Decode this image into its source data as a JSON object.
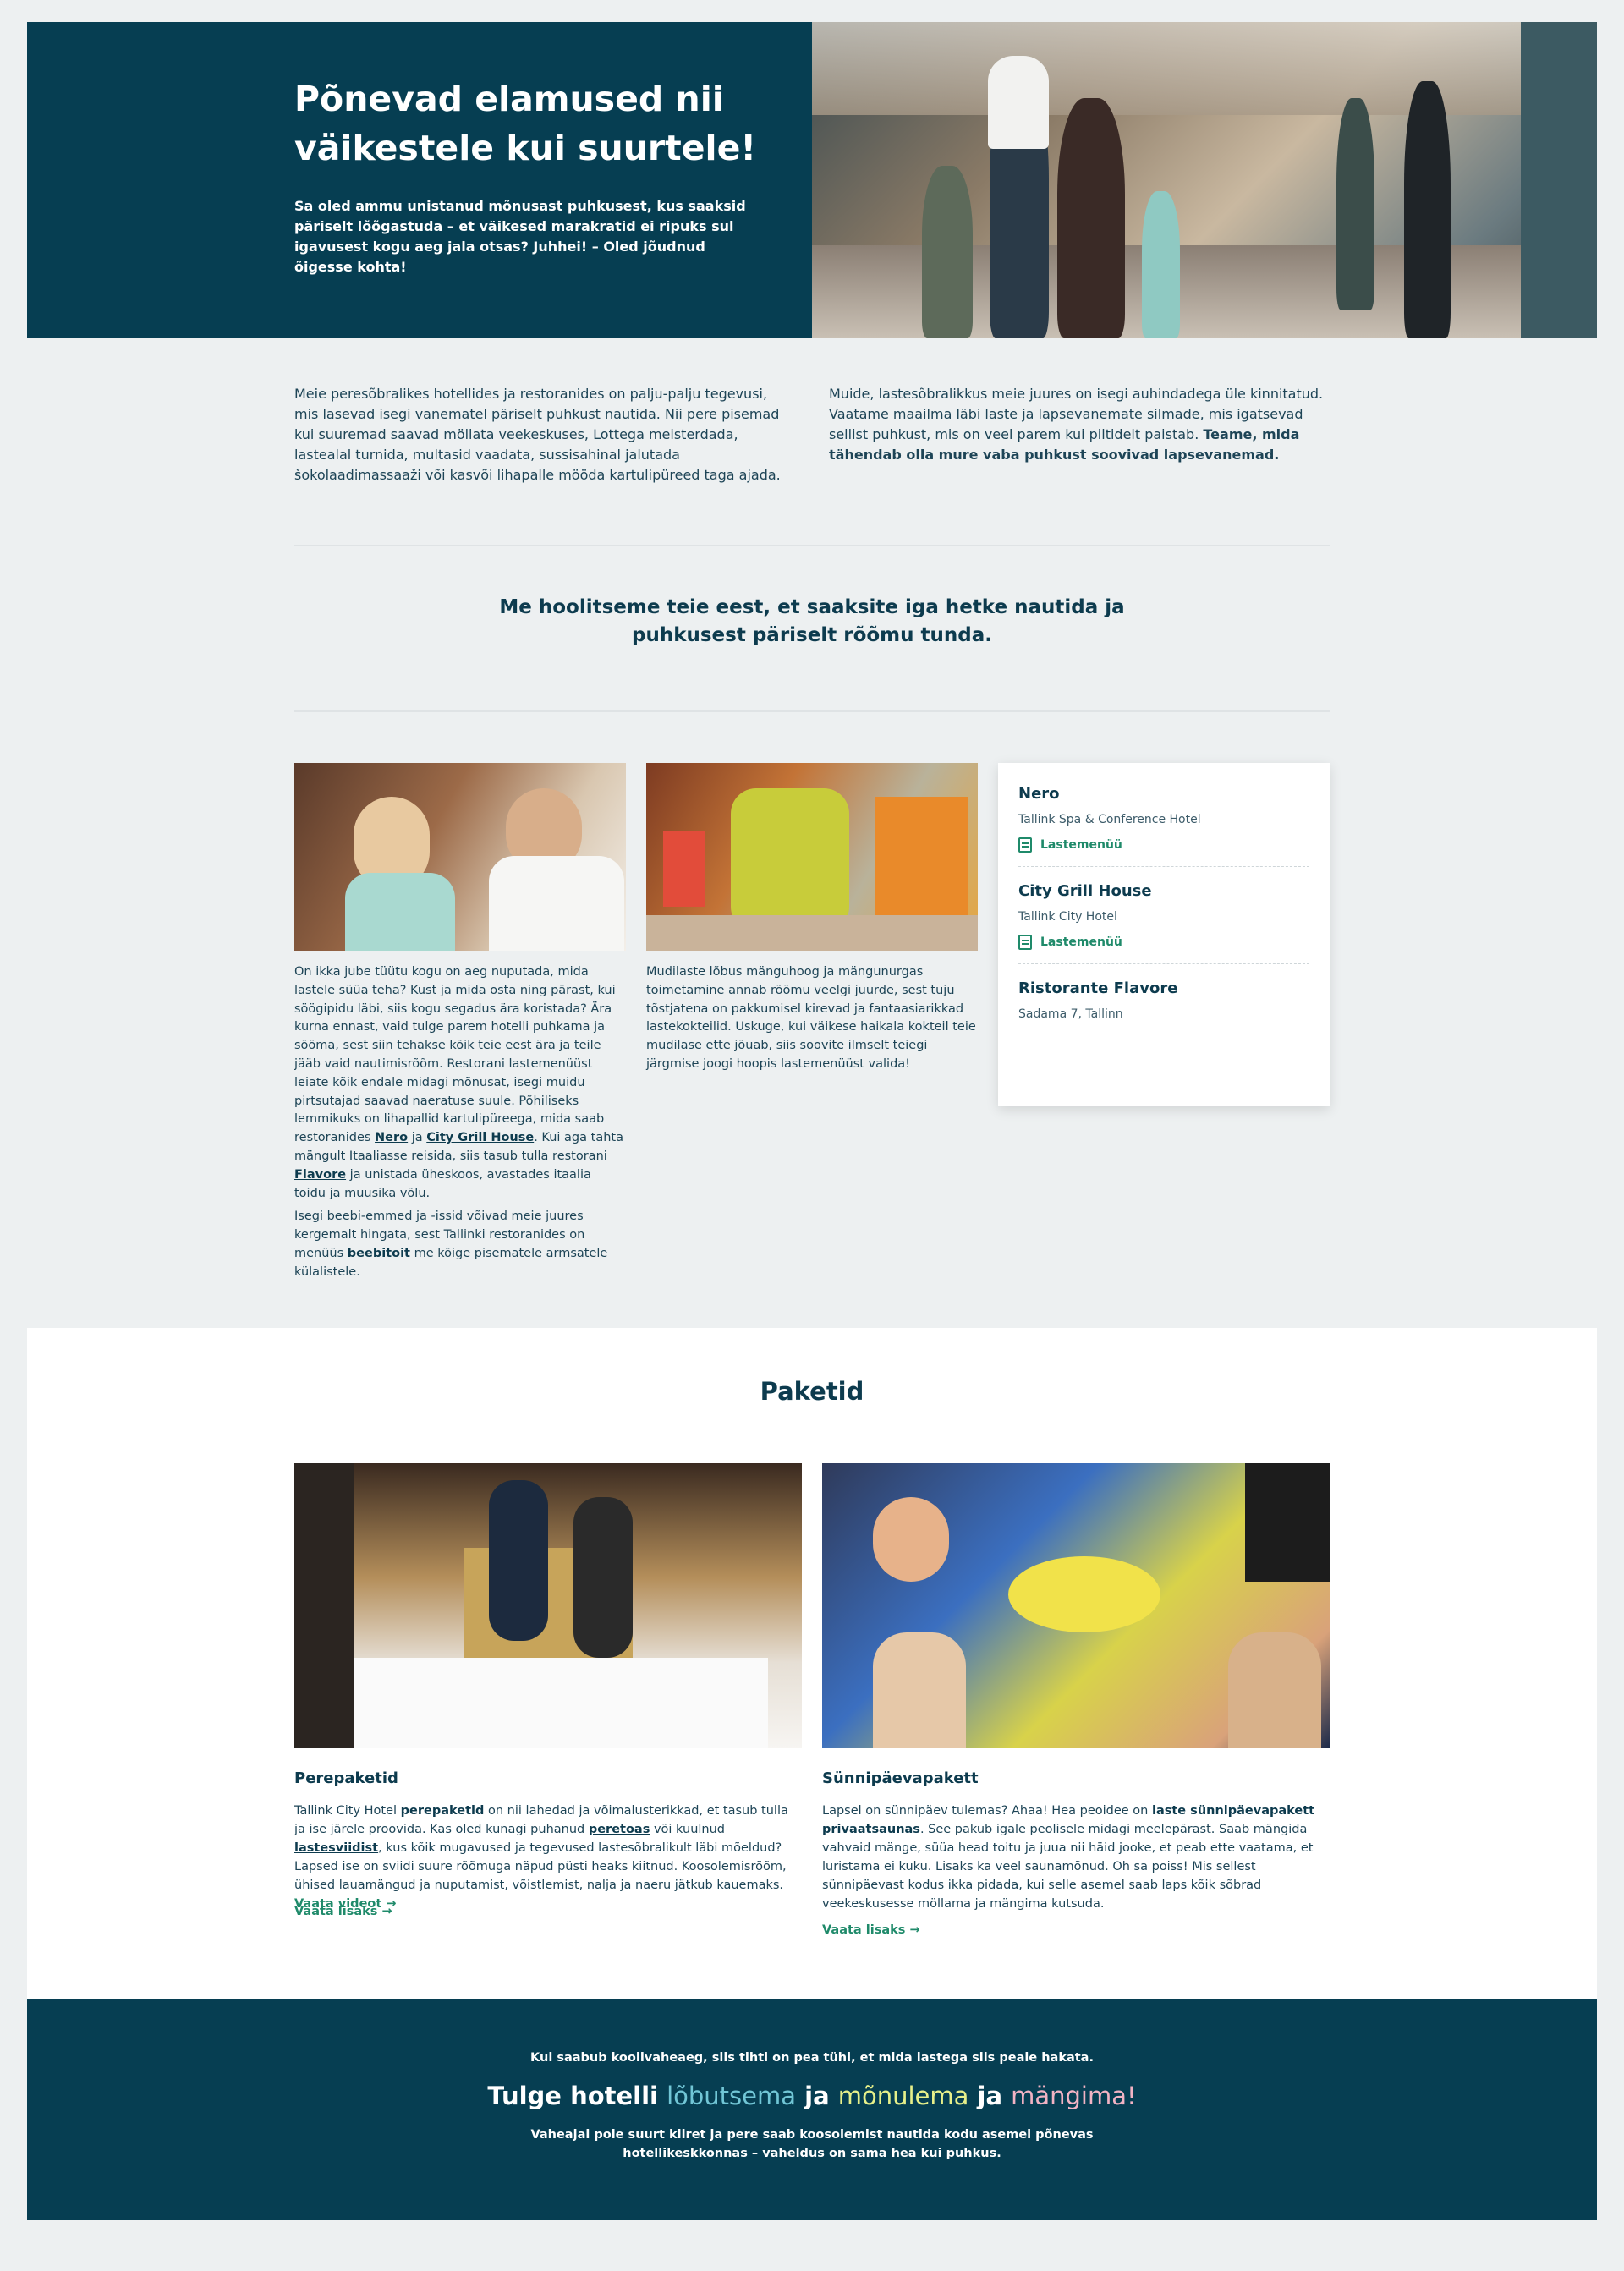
{
  "hero": {
    "title": "Põnevad elamused nii väikestele kui suurtele!",
    "text": "Sa oled ammu unistanud mõnusast puhkusest, kus saaksid päriselt lõõgastuda – et väikesed marakratid ei ripuks sul igavusest kogu aeg jala otsas? Juhhei! – Oled jõudnud õigesse kohta!"
  },
  "intro": {
    "left": "Meie peresõbralikes hotellides ja restoranides on palju-palju tegevusi, mis lasevad isegi vanematel päriselt puhkust nautida. Nii pere pisemad kui suuremad saavad möllata veekeskuses, Lottega meisterdada, lastealal turnida, multasid vaadata, sussisahinal jalutada šokolaadimassaaži või kasvõi lihapalle mööda kartulipüreed taga ajada.",
    "right_plain": "Muide, lastesõbralikkus meie juures on isegi auhindadega üle kinnitatud. Vaatame maailma läbi laste ja lapsevanemate silmade, mis igatsevad sellist puhkust, mis on veel parem kui piltidelt paistab. ",
    "right_bold": "Teame, mida tähendab olla mure vaba puhkust soovivad lapsevanemad."
  },
  "quote": "Me hoolitseme teie eest, et saaksite iga hetke nautida ja puhkusest päriselt rõõmu tunda.",
  "food": {
    "p1_a": "On ikka jube tüütu kogu on aeg nuputada, mida lastele süüa teha? Kust ja mida osta ning pärast, kui söögipidu läbi, siis kogu segadus ära koristada? Ära kurna ennast, vaid tulge parem hotelli puhkama ja sööma, sest siin tehakse kõik teie eest ära ja teile jääb vaid nautimisrõõm. Restorani lastemenüüst leiate kõik endale midagi mõnusat, isegi muidu pirtsutajad saavad naeratuse suule. Põhiliseks lemmikuks on lihapallid kartulipüreega, mida saab restoranides ",
    "link_nero": "Nero",
    "p1_b": " ja ",
    "link_city": "City Grill House",
    "p1_c": ". Kui aga tahta mängult Itaaliasse reisida, siis tasub tulla restorani ",
    "link_flavore": "Flavore",
    "p1_d": " ja unistada üheskoos, avastades itaalia toidu ja muusika võlu.",
    "p2_a": "Isegi beebi-emmed ja -issid võivad meie juures kergemalt hingata, sest Tallinki restoranides on menüüs ",
    "p2_bold": "beebitoit",
    "p2_b": " me kõige pisematele armsatele külalistele."
  },
  "play": {
    "text": "Mudilaste lõbus mänguhoog ja mängunurgas toimetamine annab rõõmu veelgi juurde, sest tuju tõstjatena on pakkumisel kirevad ja fantaasiarikkad lastekokteilid. Uskuge, kui väikese haikala kokteil teie mudilase ette jõuab, siis soovite ilmselt teiegi järgmise joogi hoopis lastemenüüst valida!"
  },
  "restaurants": [
    {
      "name": "Nero",
      "location": "Tallink Spa & Conference Hotel",
      "menu": "Lastemenüü"
    },
    {
      "name": "City Grill House",
      "location": "Tallink City Hotel",
      "menu": "Lastemenüü"
    },
    {
      "name": "Ristorante Flavore",
      "location": "Sadama 7, Tallinn"
    }
  ],
  "packages": {
    "title": "Paketid",
    "family": {
      "title": "Perepaketid",
      "t1": "Tallink City Hotel ",
      "b1": "perepaketid",
      "t2": " on nii lahedad ja võimalusterikkad, et tasub tulla ja ise järele proovida. Kas oled kunagi puhanud ",
      "l1": "peretoas",
      "t3": " või kuulnud ",
      "l2": "lastesviidist",
      "t4": ", kus kõik mugavused ja tegevused lastesõbralikult läbi mõeldud? Lapsed ise on sviidi suure rõõmuga näpud püsti heaks kiitnud. Koosolemisrõõm, ühised lauamängud ja nuputamist, võistlemist, nalja ja naeru jätkub kauemaks. ",
      "video": "Vaata videot →",
      "more": "Vaata lisaks →"
    },
    "birthday": {
      "title": "Sünnipäevapakett",
      "t1": "Lapsel on sünnipäev tulemas? Ahaa! Hea peoidee on ",
      "b1": "laste sünnipäevapakett privaatsaunas",
      "t2": ". See pakub igale peolisele midagi meelepärast. Saab mängida vahvaid mänge, süüa head toitu ja juua nii häid jooke, et peab ette vaatama, et luristama ei kuku. Lisaks ka veel saunamõnud. Oh sa poiss! Mis sellest sünnipäevast kodus ikka pidada, kui selle asemel saab laps kõik sõbrad veekeskusesse möllama ja mängima kutsuda.",
      "more": "Vaata lisaks →"
    }
  },
  "banner": {
    "small": "Kui saabub koolivaheaeg, siis tihti on pea tühi, et mida lastega siis peale hakata.",
    "title_a": "Tulge hotelli ",
    "title_c1": "lõbutsema",
    "title_b": " ja ",
    "title_c2": "mõnulema",
    "title_d": " ja ",
    "title_c3": "mängima!",
    "text": "Vaheajal pole suurt kiiret ja pere saab koosolemist nautida kodu asemel põnevas hotellikeskkonnas – vaheldus on sama hea kui puhkus."
  },
  "colors": {
    "primary": "#063e52",
    "accent_green": "#1f8a6a",
    "background": "#edf0f1"
  }
}
